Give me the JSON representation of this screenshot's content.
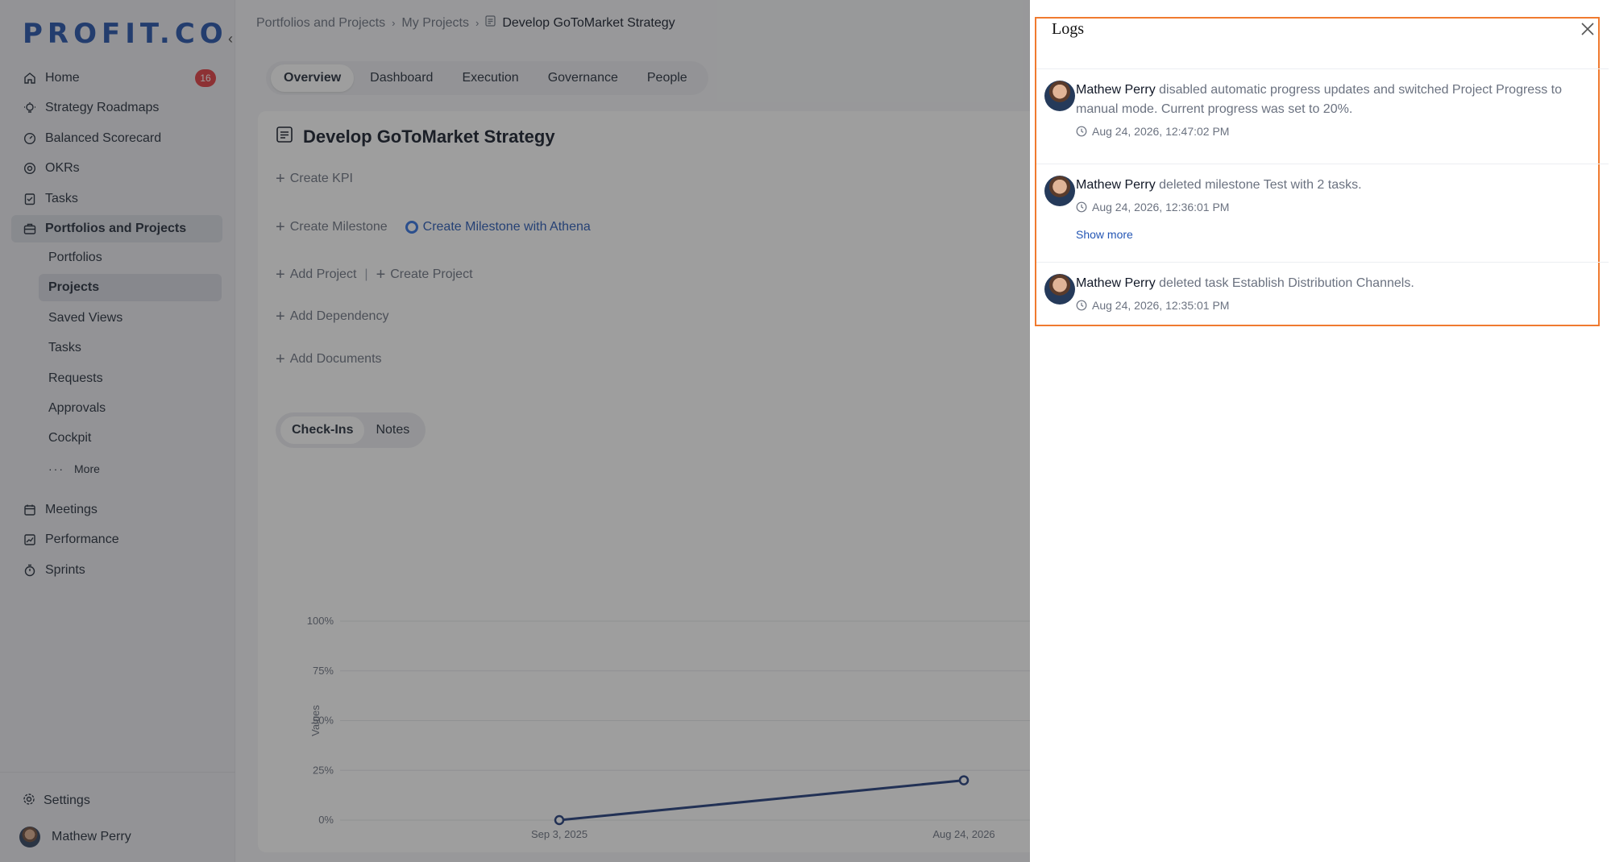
{
  "sidebar": {
    "logo": "PROFIT.CO",
    "home_badge": "16",
    "items": [
      {
        "label": "Home"
      },
      {
        "label": "Strategy Roadmaps"
      },
      {
        "label": "Balanced Scorecard"
      },
      {
        "label": "OKRs"
      },
      {
        "label": "Tasks"
      },
      {
        "label": "Portfolios and Projects"
      }
    ],
    "sub_items": [
      {
        "label": "Portfolios"
      },
      {
        "label": "Projects"
      },
      {
        "label": "Saved Views"
      },
      {
        "label": "Tasks"
      },
      {
        "label": "Requests"
      },
      {
        "label": "Approvals"
      },
      {
        "label": "Cockpit"
      }
    ],
    "more_label": "More",
    "items2": [
      {
        "label": "Meetings"
      },
      {
        "label": "Performance"
      },
      {
        "label": "Sprints"
      }
    ],
    "settings_label": "Settings",
    "user_name": "Mathew Perry"
  },
  "breadcrumb": {
    "level1": "Portfolios and Projects",
    "level2": "My Projects",
    "current": "Develop GoToMarket Strategy"
  },
  "tabs": [
    "Overview",
    "Dashboard",
    "Execution",
    "Governance",
    "People"
  ],
  "project": {
    "title": "Develop GoToMarket Strategy",
    "create_kpi": "Create KPI",
    "create_milestone": "Create Milestone",
    "create_milestone_athena": "Create Milestone with Athena",
    "add_project": "Add Project",
    "create_project": "Create Project",
    "add_dependency": "Add Dependency",
    "add_documents": "Add Documents"
  },
  "subtabs": [
    "Check-Ins",
    "Notes"
  ],
  "chart_data": {
    "type": "line",
    "ylabel": "Values",
    "yticks": [
      "100%",
      "75%",
      "50%",
      "25%",
      "0%"
    ],
    "ylim": [
      0,
      100
    ],
    "categories": [
      "Sep 3, 2025",
      "Aug 24, 2026"
    ],
    "values": [
      0,
      20
    ],
    "grid": true,
    "color": "#1e3a7a"
  },
  "logs": {
    "title": "Logs",
    "entries": [
      {
        "who": "Mathew Perry",
        "text": "disabled automatic progress updates and switched Project Progress to manual mode. Current progress was set to 20%.",
        "time": "Aug 24, 2026, 12:47:02 PM"
      },
      {
        "who": "Mathew Perry",
        "text": "deleted milestone Test with 2 tasks.",
        "time": "Aug 24, 2026, 12:36:01 PM",
        "more": "Show more"
      },
      {
        "who": "Mathew Perry",
        "text": "deleted task Establish Distribution Channels.",
        "time": "Aug 24, 2026, 12:35:01 PM"
      }
    ]
  }
}
